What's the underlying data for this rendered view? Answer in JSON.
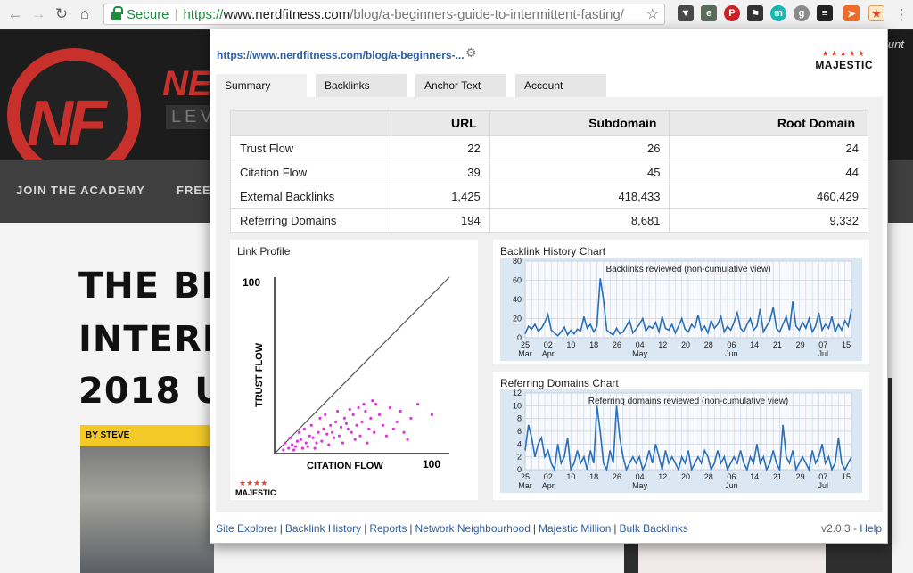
{
  "browser": {
    "secure_label": "Secure",
    "url_scheme": "https://",
    "url_host": "www.nerdfitness.com",
    "url_path": "/blog/a-beginners-guide-to-intermittent-fasting/",
    "right_peek_text": "unt"
  },
  "page": {
    "brand": "NE",
    "brand_sub": "LEV",
    "logo_letters": "NF",
    "nav": [
      "JOIN THE ACADEMY",
      "FREE"
    ],
    "headline": [
      "THE BEG",
      "INTERMI",
      "2018 UP"
    ],
    "byline": "BY STEVE"
  },
  "popup": {
    "url": "https://www.nerdfitness.com/blog/a-beginners-...",
    "logo_text": "MAJESTIC",
    "tabs": [
      "Summary",
      "Backlinks",
      "Anchor Text",
      "Account"
    ],
    "table": {
      "headers": [
        "",
        "URL",
        "Subdomain",
        "Root Domain"
      ],
      "rows": [
        [
          "Trust Flow",
          "22",
          "26",
          "24"
        ],
        [
          "Citation Flow",
          "39",
          "45",
          "44"
        ],
        [
          "External Backlinks",
          "1,425",
          "418,433",
          "460,429"
        ],
        [
          "Referring Domains",
          "194",
          "8,681",
          "9,332"
        ]
      ]
    },
    "link_profile": {
      "title": "Link Profile",
      "y_label": "TRUST FLOW",
      "x_label": "CITATION FLOW",
      "y_max_label": "100",
      "x_max_label": "100",
      "logo_text": "MAJESTIC"
    },
    "backlink_chart_title": "Backlink History Chart",
    "referring_chart_title": "Referring Domains Chart",
    "footer_links": [
      "Site Explorer",
      "Backlink History",
      "Reports",
      "Network Neighbourhood",
      "Majestic Million",
      "Bulk Backlinks"
    ],
    "version": "v2.0.3",
    "help": "Help"
  },
  "chart_data": [
    {
      "type": "line",
      "title": "Backlinks reviewed (non-cumulative view)",
      "ylim": [
        0,
        80
      ],
      "yticks": [
        "0",
        "20",
        "40",
        "60",
        "80"
      ],
      "xticks": [
        "25",
        "02",
        "10",
        "18",
        "26",
        "04",
        "12",
        "20",
        "28",
        "06",
        "14",
        "21",
        "29",
        "07",
        "15"
      ],
      "month_labels": [
        [
          "Mar",
          0
        ],
        [
          "Apr",
          1
        ],
        [
          "May",
          5
        ],
        [
          "Jun",
          9
        ],
        [
          "Jul",
          13
        ]
      ],
      "values": [
        4,
        12,
        9,
        14,
        7,
        10,
        16,
        24,
        8,
        5,
        2,
        6,
        11,
        3,
        8,
        4,
        9,
        7,
        22,
        10,
        14,
        6,
        12,
        62,
        40,
        8,
        5,
        3,
        10,
        4,
        6,
        12,
        18,
        5,
        9,
        14,
        20,
        7,
        12,
        10,
        16,
        6,
        22,
        10,
        8,
        14,
        5,
        12,
        20,
        9,
        6,
        14,
        10,
        24,
        8,
        12,
        5,
        18,
        10,
        14,
        22,
        6,
        12,
        8,
        16,
        26,
        10,
        6,
        14,
        20,
        8,
        12,
        30,
        6,
        12,
        18,
        32,
        10,
        6,
        14,
        22,
        8,
        38,
        12,
        8,
        16,
        10,
        20,
        6,
        12,
        26,
        8,
        14,
        10,
        22,
        6,
        14,
        8,
        18,
        12,
        30
      ]
    },
    {
      "type": "line",
      "title": "Referring domains reviewed (non-cumulative view)",
      "ylim": [
        0,
        12
      ],
      "yticks": [
        "0",
        "2",
        "4",
        "6",
        "8",
        "10",
        "12"
      ],
      "xticks": [
        "25",
        "02",
        "10",
        "18",
        "26",
        "04",
        "12",
        "20",
        "28",
        "06",
        "14",
        "21",
        "29",
        "07",
        "15"
      ],
      "month_labels": [
        [
          "Mar",
          0
        ],
        [
          "Apr",
          1
        ],
        [
          "May",
          5
        ],
        [
          "Jun",
          9
        ],
        [
          "Jul",
          13
        ]
      ],
      "values": [
        3,
        7,
        5,
        2,
        4,
        5,
        2,
        3,
        1,
        0,
        4,
        1,
        2,
        5,
        0,
        1,
        3,
        1,
        2,
        0,
        3,
        1,
        10,
        6,
        1,
        0,
        3,
        1,
        10,
        5,
        2,
        0,
        1,
        2,
        1,
        2,
        0,
        1,
        3,
        1,
        4,
        2,
        0,
        3,
        1,
        2,
        1,
        0,
        2,
        1,
        3,
        0,
        1,
        2,
        1,
        3,
        2,
        0,
        1,
        3,
        1,
        2,
        0,
        1,
        2,
        1,
        3,
        1,
        0,
        2,
        1,
        4,
        1,
        2,
        0,
        1,
        3,
        1,
        0,
        7,
        2,
        1,
        3,
        0,
        1,
        2,
        1,
        0,
        3,
        1,
        2,
        4,
        1,
        2,
        0,
        1,
        5,
        1,
        0,
        1,
        2
      ]
    },
    {
      "type": "scatter",
      "title": "Link Profile",
      "xlabel": "CITATION FLOW",
      "ylabel": "TRUST FLOW",
      "xlim": [
        0,
        100
      ],
      "ylim": [
        0,
        100
      ],
      "points": [
        [
          5,
          2
        ],
        [
          8,
          3
        ],
        [
          10,
          5
        ],
        [
          12,
          4
        ],
        [
          15,
          8
        ],
        [
          18,
          6
        ],
        [
          20,
          10
        ],
        [
          22,
          9
        ],
        [
          25,
          12
        ],
        [
          28,
          14
        ],
        [
          30,
          11
        ],
        [
          32,
          16
        ],
        [
          35,
          18
        ],
        [
          38,
          15
        ],
        [
          40,
          20
        ],
        [
          42,
          14
        ],
        [
          45,
          22
        ],
        [
          48,
          26
        ],
        [
          50,
          18
        ],
        [
          52,
          24
        ],
        [
          55,
          20
        ],
        [
          58,
          28
        ],
        [
          14,
          12
        ],
        [
          16,
          3
        ],
        [
          24,
          6
        ],
        [
          26,
          20
        ],
        [
          34,
          9
        ],
        [
          36,
          24
        ],
        [
          44,
          12
        ],
        [
          46,
          8
        ],
        [
          54,
          14
        ],
        [
          56,
          30
        ],
        [
          60,
          22
        ],
        [
          66,
          26
        ],
        [
          70,
          18
        ],
        [
          72,
          24
        ],
        [
          78,
          20
        ],
        [
          82,
          28
        ],
        [
          90,
          22
        ],
        [
          6,
          6
        ],
        [
          9,
          9
        ],
        [
          11,
          2
        ],
        [
          13,
          7
        ],
        [
          17,
          14
        ],
        [
          19,
          4
        ],
        [
          21,
          16
        ],
        [
          23,
          3
        ],
        [
          27,
          7
        ],
        [
          29,
          22
        ],
        [
          31,
          5
        ],
        [
          33,
          12
        ],
        [
          37,
          10
        ],
        [
          39,
          6
        ],
        [
          41,
          17
        ],
        [
          43,
          25
        ],
        [
          47,
          16
        ],
        [
          49,
          10
        ],
        [
          51,
          28
        ],
        [
          53,
          6
        ],
        [
          57,
          12
        ],
        [
          62,
          16
        ],
        [
          64,
          10
        ],
        [
          68,
          14
        ],
        [
          74,
          12
        ],
        [
          76,
          8
        ]
      ]
    }
  ]
}
